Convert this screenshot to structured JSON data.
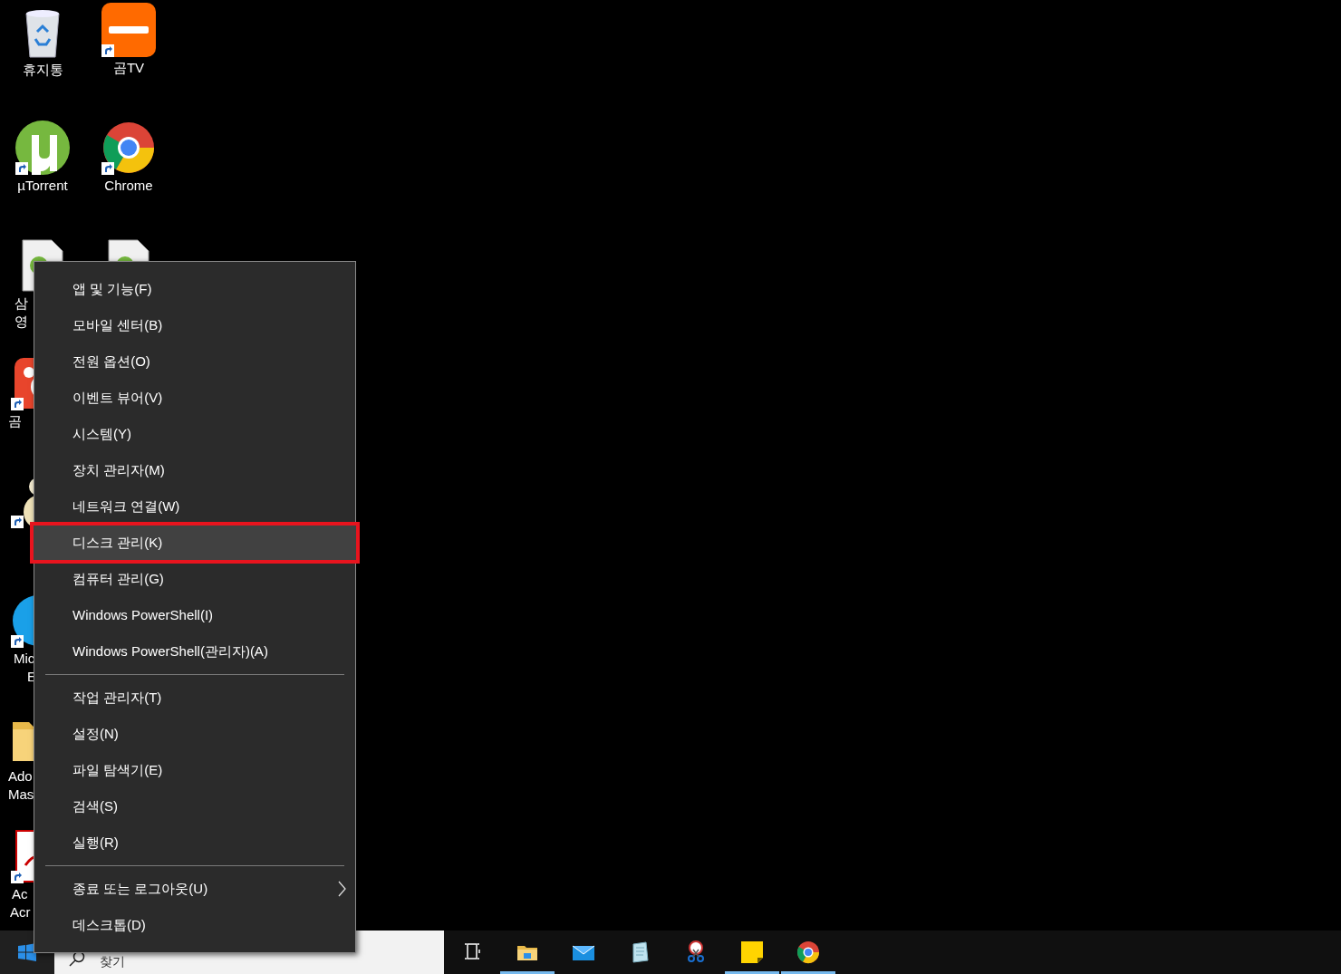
{
  "desktop_icons": [
    {
      "kind": "recycle_bin",
      "label_lines": [
        "휴지통"
      ],
      "shortcut": false
    },
    {
      "kind": "gomtv",
      "label_lines": [
        "곰TV"
      ],
      "shortcut": true
    },
    {
      "kind": "utorrent",
      "label_lines": [
        "µTorrent"
      ],
      "shortcut": true
    },
    {
      "kind": "chrome",
      "label_lines": [
        "Chrome"
      ],
      "shortcut": true
    },
    {
      "kind": "torrent_file",
      "label_lines": [
        "삼",
        "영"
      ]
    },
    {
      "kind": "torrent_file"
    },
    {
      "kind": "gomplayer",
      "label_lines": [
        "곰"
      ],
      "shortcut": true
    },
    {
      "kind": "figure",
      "shortcut": true
    },
    {
      "kind": "edge",
      "label_lines": [
        "Mic",
        "E"
      ],
      "shortcut": true
    },
    {
      "kind": "folder",
      "label_lines": [
        "Ado",
        "Mas"
      ],
      "shortcut": false
    },
    {
      "kind": "acrobat",
      "label_lines": [
        "Ac",
        "Acr"
      ],
      "shortcut": true
    }
  ],
  "context_menu": {
    "items": [
      {
        "kind": "item",
        "label": "앱 및 기능(F)",
        "selected": false,
        "submenu": false
      },
      {
        "kind": "item",
        "label": "모바일 센터(B)",
        "selected": false,
        "submenu": false
      },
      {
        "kind": "item",
        "label": "전원 옵션(O)",
        "selected": false,
        "submenu": false
      },
      {
        "kind": "item",
        "label": "이벤트 뷰어(V)",
        "selected": false,
        "submenu": false
      },
      {
        "kind": "item",
        "label": "시스템(Y)",
        "selected": false,
        "submenu": false
      },
      {
        "kind": "item",
        "label": "장치 관리자(M)",
        "selected": false,
        "submenu": false
      },
      {
        "kind": "item",
        "label": "네트워크 연결(W)",
        "selected": false,
        "submenu": false
      },
      {
        "kind": "item",
        "label": "디스크 관리(K)",
        "selected": true,
        "submenu": false
      },
      {
        "kind": "item",
        "label": "컴퓨터 관리(G)",
        "selected": false,
        "submenu": false
      },
      {
        "kind": "item",
        "label": "Windows PowerShell(I)",
        "selected": false,
        "submenu": false
      },
      {
        "kind": "item",
        "label": "Windows PowerShell(관리자)(A)",
        "selected": false,
        "submenu": false
      },
      {
        "kind": "separator"
      },
      {
        "kind": "item",
        "label": "작업 관리자(T)",
        "selected": false,
        "submenu": false
      },
      {
        "kind": "item",
        "label": "설정(N)",
        "selected": false,
        "submenu": false
      },
      {
        "kind": "item",
        "label": "파일 탐색기(E)",
        "selected": false,
        "submenu": false
      },
      {
        "kind": "item",
        "label": "검색(S)",
        "selected": false,
        "submenu": false
      },
      {
        "kind": "item",
        "label": "실행(R)",
        "selected": false,
        "submenu": false
      },
      {
        "kind": "separator"
      },
      {
        "kind": "item",
        "label": "종료 또는 로그아웃(U)",
        "selected": false,
        "submenu": true
      },
      {
        "kind": "item",
        "label": "데스크톱(D)",
        "selected": false,
        "submenu": false
      }
    ]
  },
  "taskbar": {
    "search": {
      "placeholder": "찾기"
    },
    "apps": [
      {
        "kind": "task_view",
        "active": false
      },
      {
        "kind": "file_explorer",
        "active": true
      },
      {
        "kind": "mail",
        "active": false
      },
      {
        "kind": "notepad",
        "active": false
      },
      {
        "kind": "snipping",
        "active": false
      },
      {
        "kind": "sticky_notes",
        "active": true
      },
      {
        "kind": "chrome",
        "active": true
      }
    ]
  }
}
